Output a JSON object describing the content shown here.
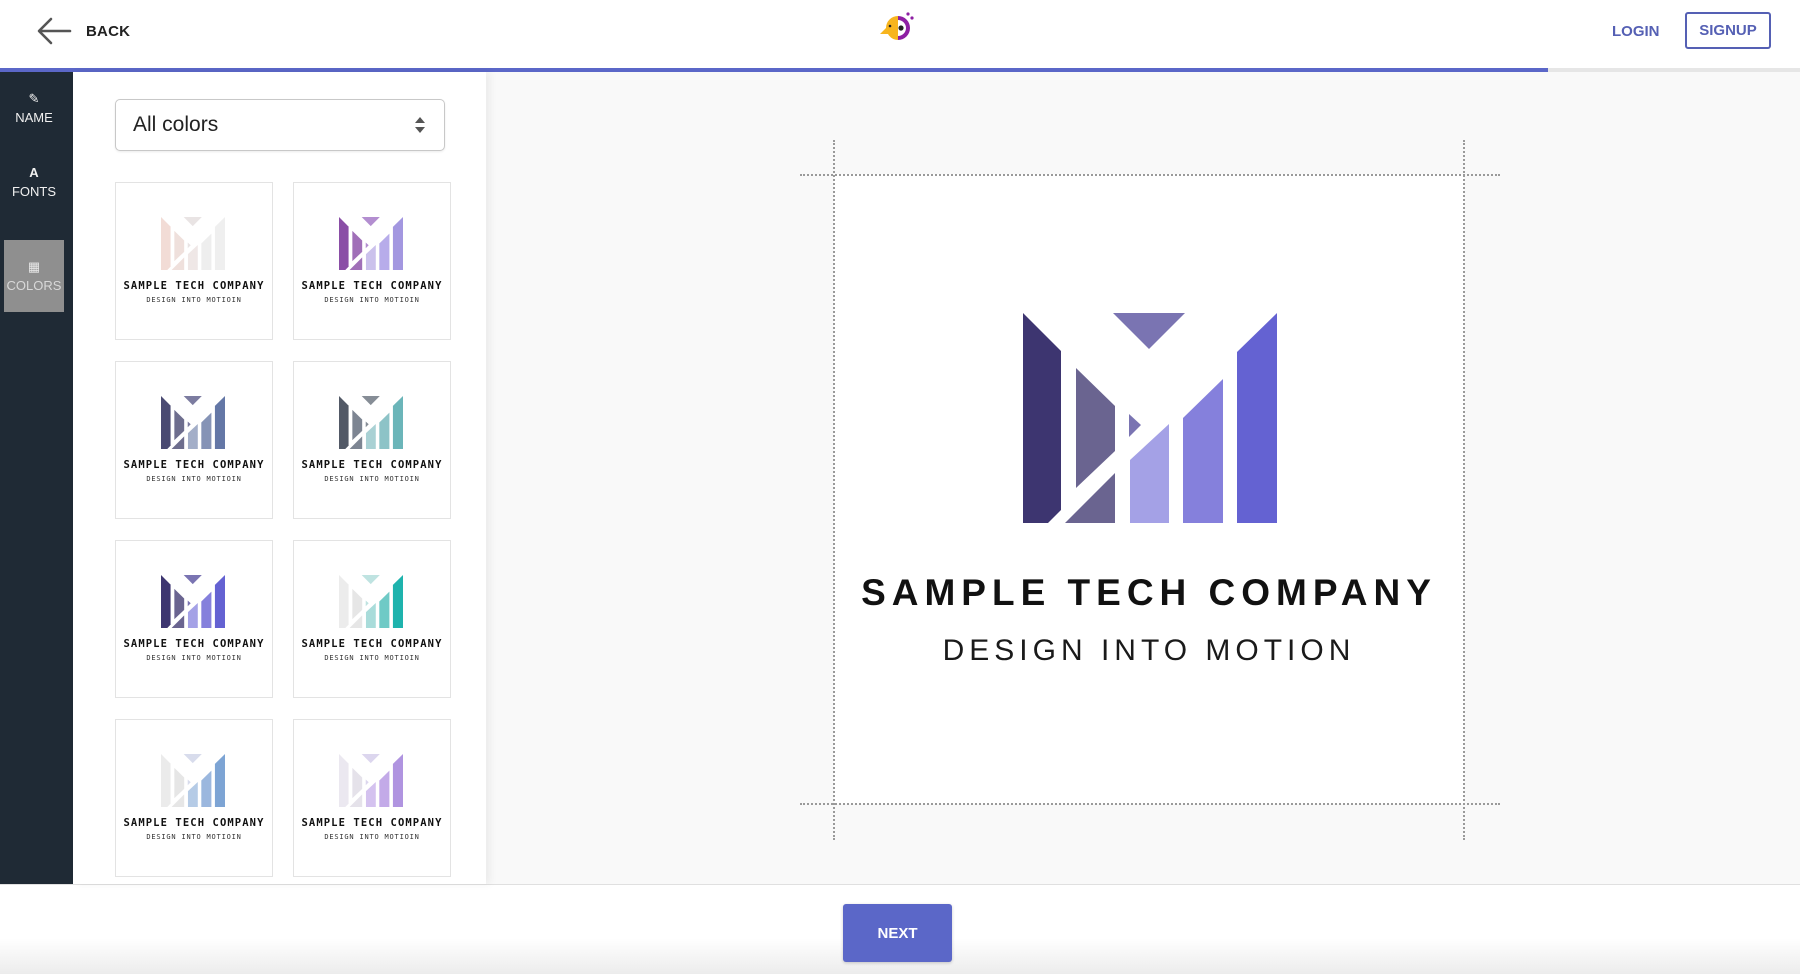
{
  "header": {
    "back_label": "BACK",
    "back_icon": "arrow-left-icon",
    "brand_icon": "parrot-logo-icon",
    "login_label": "LOGIN",
    "signup_label": "SIGNUP",
    "progress_percent": 86,
    "accent_color": "#5b67c8"
  },
  "sidebar": {
    "items": [
      {
        "label": "NAME",
        "icon": "edit-icon",
        "glyph": "✎",
        "active": false
      },
      {
        "label": "FONTS",
        "icon": "font-icon",
        "glyph": "A",
        "active": false
      },
      {
        "label": "COLORS",
        "icon": "palette-icon",
        "glyph": "▦",
        "active": true
      }
    ]
  },
  "panel": {
    "filter_select": {
      "value": "All colors"
    },
    "cards": [
      {
        "title": "SAMPLE TECH COMPANY",
        "subtitle": "DESIGN INTO MOTIOIN",
        "palette": [
          "#f2dcd6",
          "#efe0dc",
          "#efe7e6",
          "#eeeeee",
          "#efefef",
          "#e9e4e4"
        ]
      },
      {
        "title": "SAMPLE TECH COMPANY",
        "subtitle": "DESIGN INTO MOTIOIN",
        "palette": [
          "#8a4ea6",
          "#a06fb8",
          "#cbc1ec",
          "#b7acea",
          "#a397e0",
          "#b38ed0"
        ]
      },
      {
        "title": "SAMPLE TECH COMPANY",
        "subtitle": "DESIGN INTO MOTIOIN",
        "palette": [
          "#4a4a72",
          "#6e6e8e",
          "#a3aec8",
          "#8593b6",
          "#6477a6",
          "#7c7ca0"
        ]
      },
      {
        "title": "SAMPLE TECH COMPANY",
        "subtitle": "DESIGN INTO MOTIOIN",
        "palette": [
          "#525966",
          "#7d8592",
          "#a9d1d4",
          "#8dc3c7",
          "#6bb5b9",
          "#868d96"
        ]
      },
      {
        "title": "SAMPLE TECH COMPANY",
        "subtitle": "DESIGN INTO MOTIOIN",
        "palette": [
          "#3d3570",
          "#6a6490",
          "#a4a1e6",
          "#8580dc",
          "#6462d2",
          "#7a74b2"
        ]
      },
      {
        "title": "SAMPLE TECH COMPANY",
        "subtitle": "DESIGN INTO MOTIOIN",
        "palette": [
          "#ececec",
          "#e6e6e6",
          "#a9dcda",
          "#6fcac6",
          "#1eb3ad",
          "#bfe3e1"
        ]
      },
      {
        "title": "SAMPLE TECH COMPANY",
        "subtitle": "DESIGN INTO MOTIOIN",
        "palette": [
          "#ebebeb",
          "#e6e6e6",
          "#b5cbe6",
          "#9bb7de",
          "#7da4d4",
          "#d8dcec"
        ]
      },
      {
        "title": "SAMPLE TECH COMPANY",
        "subtitle": "DESIGN INTO MOTIOIN",
        "palette": [
          "#ebe8f0",
          "#e5e2ea",
          "#d4c2ef",
          "#c3aae8",
          "#b094e0",
          "#dcd6ee"
        ]
      }
    ]
  },
  "preview": {
    "title": "SAMPLE TECH COMPANY",
    "subtitle": "DESIGN INTO MOTION",
    "palette": [
      "#3d3570",
      "#6a6490",
      "#a4a1e6",
      "#8580dc",
      "#6462d2",
      "#7a74b2"
    ]
  },
  "footer": {
    "next_label": "NEXT"
  }
}
